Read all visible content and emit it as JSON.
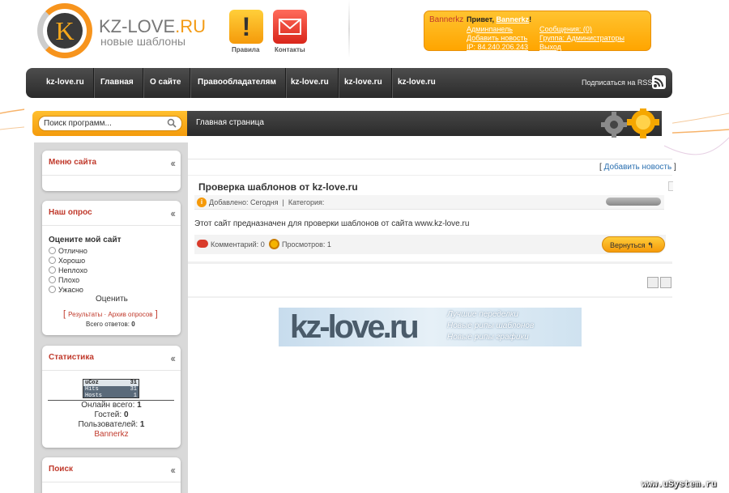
{
  "header": {
    "logo_letter": "K",
    "logo_text_a": "KZ-LOVE",
    "logo_text_b": ".RU",
    "logo_sub": "новые шаблоны",
    "rules_label": "Правила",
    "contacts_label": "Контакты"
  },
  "userbox": {
    "username": "Bannerkz",
    "greeting": "Привет,",
    "greeting_name": "Bannerkz",
    "greeting_end": "!",
    "admin_panel": "Админпанель",
    "add_news": "Добавить новость",
    "ip": "IP: 84.240.206.243",
    "messages": "Сообщения: (0)",
    "group": "Группа: Администраторы",
    "logout": "Выход"
  },
  "nav": {
    "items": [
      "kz-love.ru",
      "Главная",
      "О сайте",
      "Правообладателям",
      "kz-love.ru",
      "kz-love.ru",
      "kz-love.ru"
    ],
    "rss": "Подписаться на RSS"
  },
  "search": {
    "value": "Поиск программ...",
    "breadcrumb": "Главная страница"
  },
  "sidebar": {
    "menu_title": "Меню сайта",
    "poll_title": "Наш опрос",
    "poll_question": "Оцените мой сайт",
    "poll_options": [
      "Отлично",
      "Хорошо",
      "Неплохо",
      "Плохо",
      "Ужасно"
    ],
    "poll_vote": "Оценить",
    "poll_results": "Результаты",
    "poll_archive": "Архив опросов",
    "poll_total_label": "Всего ответов:",
    "poll_total": "0",
    "stats_title": "Статистика",
    "counter_label": "uCoz",
    "counter_rows": [
      {
        "k": "uCoz",
        "v": "31"
      },
      {
        "k": "Hits",
        "v": "31"
      },
      {
        "k": "Hosts",
        "v": "1"
      }
    ],
    "online_label": "Онлайн всего:",
    "online_value": "1",
    "guests_label": "Гостей:",
    "guests_value": "0",
    "users_label": "Пользователей:",
    "users_value": "1",
    "online_user": "Bannerkz",
    "search_title": "Поиск"
  },
  "content": {
    "add_news": "Добавить новость",
    "title": "Проверка шаблонов от kz-love.ru",
    "added_label": "Добавлено:",
    "added_value": "Сегодня",
    "category_label": "Категория:",
    "body": "Этот сайт предназначен для проверки шаблонов от сайта www.kz-love.ru",
    "comments_label": "Комментарий:",
    "comments_value": "0",
    "views_label": "Просмотров:",
    "views_value": "1",
    "back": "Вернуться"
  },
  "banner": {
    "logo": "kz-love.ru",
    "lines": [
      "Лучшие переделки",
      "Новые рипы шаблонов",
      "Новые рипы графики"
    ]
  },
  "watermark": "www.uSystem.ru",
  "colors": {
    "accent": "#f7941d",
    "title_red": "#c0392b",
    "link_blue": "#2a6fb0",
    "nav_dark": "#333333"
  }
}
